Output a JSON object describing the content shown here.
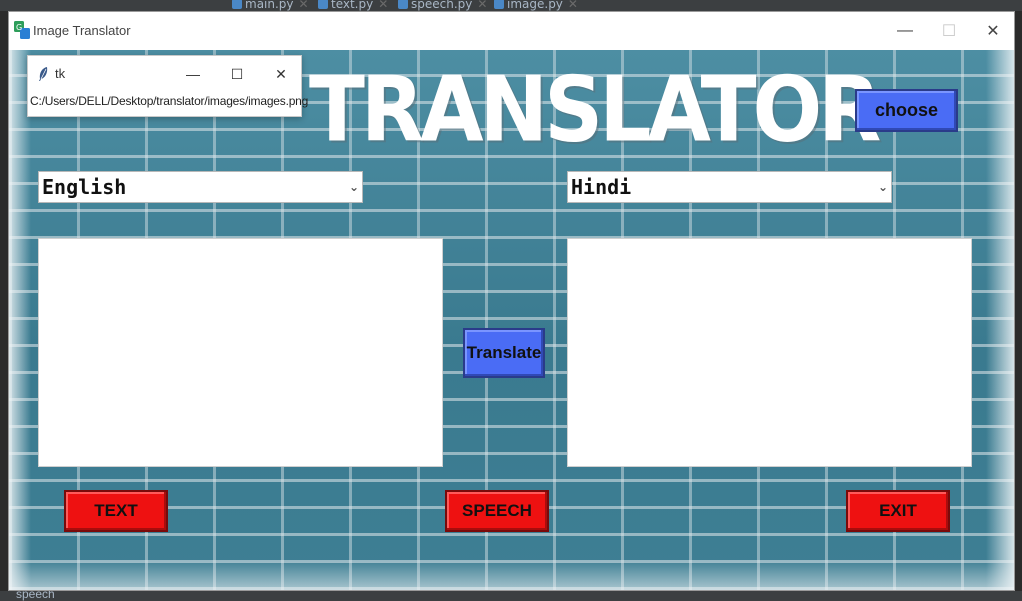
{
  "ide": {
    "tabs": [
      "main.py",
      "text.py",
      "speech.py",
      "image.py"
    ],
    "bottom_item": "speech"
  },
  "window": {
    "title": "Image Translator",
    "minimize_glyph": "—",
    "maximize_glyph": "☐",
    "close_glyph": "✕"
  },
  "tk_popup": {
    "title": "tk",
    "path": "C:/Users/DELL/Desktop/translator/images/images.png"
  },
  "app": {
    "headline": "TRANSLATOR",
    "choose_label": "choose",
    "source_language": "English",
    "target_language": "Hindi",
    "translate_label": "Translate",
    "text_label": "TEXT",
    "speech_label": "SPEECH",
    "exit_label": "EXIT",
    "input_text": "",
    "output_text": ""
  },
  "colors": {
    "blue_button": "#4a6cf5",
    "red_button": "#ee1111",
    "brick": "#3f7d92"
  },
  "icons": {
    "app": "translate-app-icon",
    "tk": "feather-icon",
    "dropdown": "chevron-down-icon"
  }
}
